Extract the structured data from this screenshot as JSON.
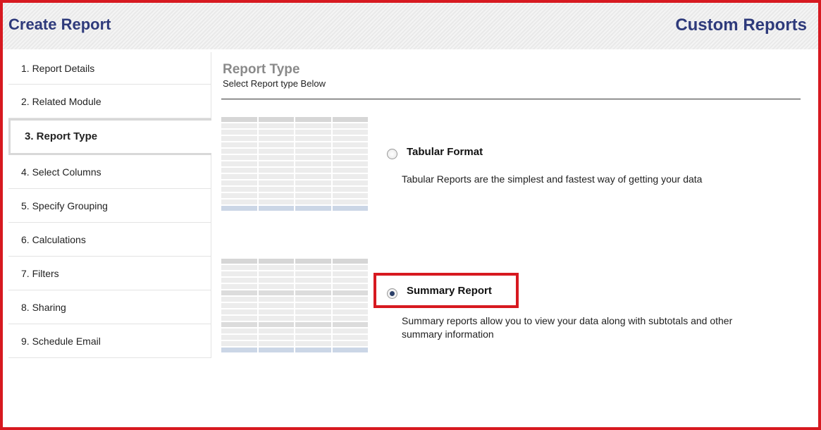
{
  "header": {
    "title": "Create Report",
    "module": "Custom Reports"
  },
  "steps": [
    {
      "label": "1. Report Details",
      "active": false
    },
    {
      "label": "2. Related Module",
      "active": false
    },
    {
      "label": "3. Report Type",
      "active": true
    },
    {
      "label": "4. Select Columns",
      "active": false
    },
    {
      "label": "5. Specify Grouping",
      "active": false
    },
    {
      "label": "6. Calculations",
      "active": false
    },
    {
      "label": "7. Filters",
      "active": false
    },
    {
      "label": "8. Sharing",
      "active": false
    },
    {
      "label": "9. Schedule Email",
      "active": false
    }
  ],
  "main": {
    "title": "Report Type",
    "subtitle": "Select Report type Below",
    "options": [
      {
        "label": "Tabular Format",
        "description": "Tabular Reports are the simplest and fastest way of getting your data",
        "selected": false
      },
      {
        "label": "Summary Report",
        "description_line1": "Summary reports allow you to view your data along with subtotals and other",
        "description_line2": "summary information",
        "selected": true
      }
    ]
  },
  "colors": {
    "accent_title": "#2e3a7b",
    "highlight_border": "#d71920"
  }
}
